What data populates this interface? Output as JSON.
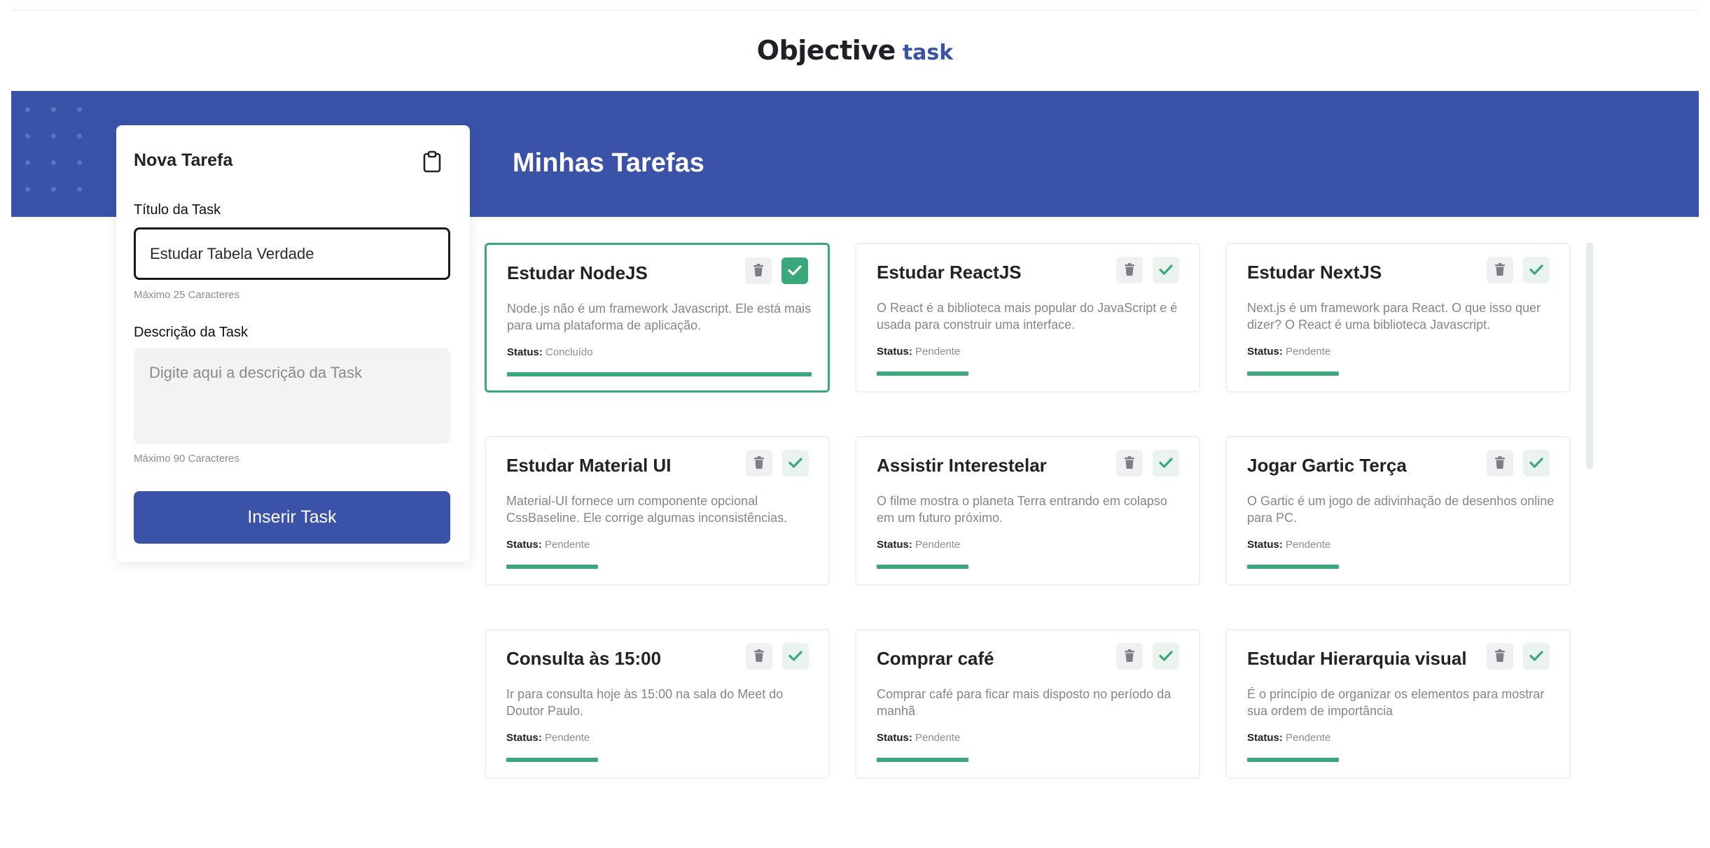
{
  "app": {
    "logo_main": "Objective",
    "logo_accent": "task",
    "page_title": "Minhas Tarefas"
  },
  "colors": {
    "brand": "#3a53a8",
    "accent_green": "#3aa87a",
    "text_dark": "#222327",
    "text_muted": "#83868c"
  },
  "form": {
    "title": "Nova Tarefa",
    "icon": "clipboard-icon",
    "title_label": "Título da Task",
    "title_value": "Estudar Tabela Verdade",
    "title_hint": "Máximo 25 Caracteres",
    "desc_label": "Descrição da Task",
    "desc_placeholder": "Digite aqui a descrição da Task",
    "desc_hint": "Máximo 90 Caracteres",
    "submit_label": "Inserir Task"
  },
  "status_label": "Status:",
  "tasks": [
    {
      "title": "Estudar NodeJS",
      "description": "Node.js não é um framework Javascript. Ele está mais para uma plataforma de aplicação.",
      "status": "Concluído",
      "progress": 1.0,
      "done": true
    },
    {
      "title": "Estudar ReactJS",
      "description": "O React é a biblioteca mais popular do JavaScript e é usada para construir uma interface.",
      "status": "Pendente",
      "progress": 0.3,
      "done": false
    },
    {
      "title": "Estudar NextJS",
      "description": "Next.js é um framework para React. O que isso quer dizer? O React é uma biblioteca Javascript.",
      "status": "Pendente",
      "progress": 0.3,
      "done": false
    },
    {
      "title": "Estudar Material UI",
      "description": "Material-UI fornece um componente opcional CssBaseline. Ele corrige algumas inconsistências.",
      "status": "Pendente",
      "progress": 0.3,
      "done": false
    },
    {
      "title": "Assistir Interestelar",
      "description": "O filme mostra o planeta Terra entrando em colapso em um futuro próximo.",
      "status": "Pendente",
      "progress": 0.3,
      "done": false
    },
    {
      "title": "Jogar Gartic Terça",
      "description": "O Gartic é um jogo de adivinhação de desenhos online para PC.",
      "status": "Pendente",
      "progress": 0.3,
      "done": false
    },
    {
      "title": "Consulta às 15:00",
      "description": "Ir para consulta hoje às 15:00 na sala do Meet do Doutor Paulo.",
      "status": "Pendente",
      "progress": 0.3,
      "done": false
    },
    {
      "title": "Comprar café",
      "description": "Comprar café para ficar mais disposto no período da manhã",
      "status": "Pendente",
      "progress": 0.3,
      "done": false
    },
    {
      "title": "Estudar Hierarquia visual",
      "description": "É o princípio de organizar os elementos para mostrar sua ordem de importância",
      "status": "Pendente",
      "progress": 0.3,
      "done": false
    }
  ]
}
